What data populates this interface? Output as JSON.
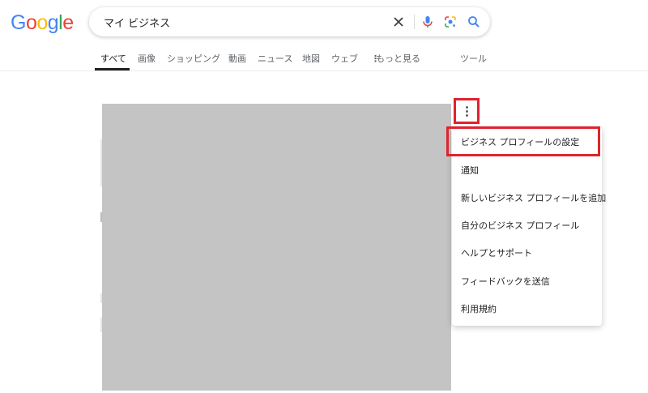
{
  "logo": {
    "letters": [
      {
        "ch": "G",
        "color": "#4285F4"
      },
      {
        "ch": "o",
        "color": "#EA4335"
      },
      {
        "ch": "o",
        "color": "#FBBC05"
      },
      {
        "ch": "g",
        "color": "#4285F4"
      },
      {
        "ch": "l",
        "color": "#34A853"
      },
      {
        "ch": "e",
        "color": "#EA4335"
      }
    ]
  },
  "search": {
    "query": "マイ ビジネス",
    "icons": [
      "close-icon",
      "microphone-icon",
      "google-lens-icon",
      "search-icon"
    ]
  },
  "tabs": [
    {
      "label": "すべて",
      "active": true
    },
    {
      "label": "画像"
    },
    {
      "label": "ショッピング"
    },
    {
      "label": "動画"
    },
    {
      "label": "ニュース"
    },
    {
      "label": "地図"
    },
    {
      "label": "ウェブ"
    },
    {
      "label": "もっと見る",
      "icon": "more-vert-icon"
    },
    {
      "label": "ツール"
    }
  ],
  "menu": {
    "trigger_icon": "more-vert-icon",
    "items": [
      {
        "label": "ビジネス プロフィールの設定",
        "highlighted": true
      },
      {
        "label": "通知"
      },
      {
        "label": "新しいビジネス プロフィールを追加"
      },
      {
        "label": "自分のビジネス プロフィール"
      },
      {
        "label": "ヘルプとサポート"
      },
      {
        "label": "フィードバックを送信"
      },
      {
        "label": "利用規約"
      }
    ]
  },
  "colors": {
    "highlight": "#e0232d",
    "redacted_block": "#c4c4c4"
  }
}
